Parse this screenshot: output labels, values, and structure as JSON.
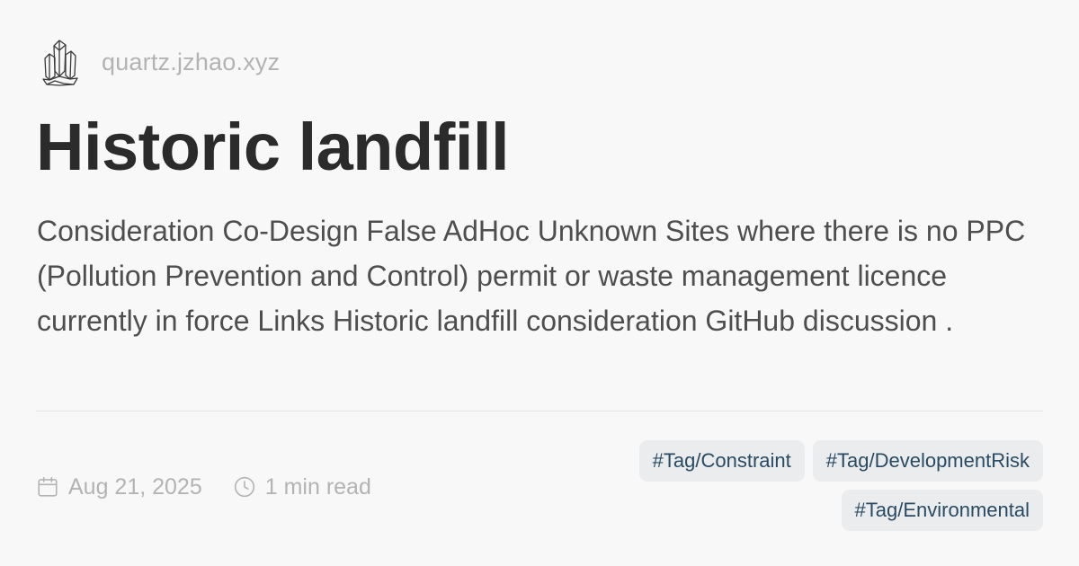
{
  "site": {
    "domain": "quartz.jzhao.xyz",
    "logo_icon": "crystal-cluster-icon"
  },
  "page": {
    "title": "Historic landfill",
    "description": "Consideration Co-Design False AdHoc Unknown Sites where there is no PPC (Pollution Prevention and Control) permit or waste management licence currently in force Links Historic landfill consideration GitHub discussion ."
  },
  "meta": {
    "date": "Aug 21, 2025",
    "date_icon": "calendar-icon",
    "reading_time": "1 min read",
    "reading_time_icon": "clock-icon"
  },
  "tags": [
    "#Tag/Constraint",
    "#Tag/DevelopmentRisk",
    "#Tag/Environmental"
  ],
  "colors": {
    "background": "#f9f8f8",
    "title": "#2b2b2b",
    "body_text": "#4e4e4e",
    "muted_text": "#b3b3b5",
    "tag_background": "#ebecee",
    "tag_text": "#284b63"
  }
}
